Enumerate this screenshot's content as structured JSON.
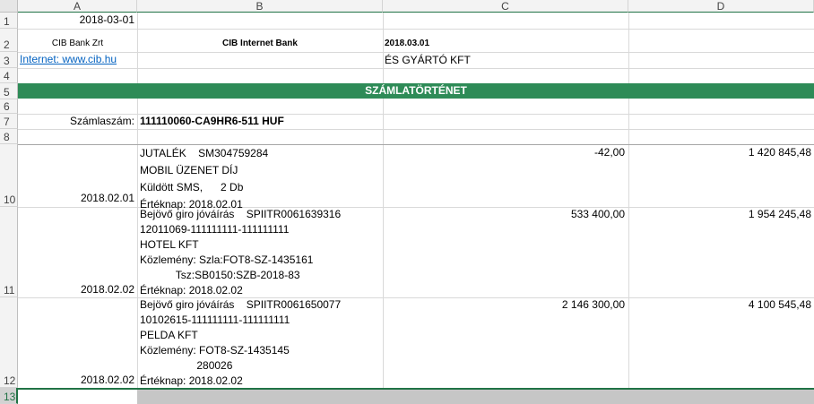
{
  "columns": [
    "A",
    "B",
    "C",
    "D"
  ],
  "rows": [
    "1",
    "2",
    "3",
    "4",
    "5",
    "6",
    "7",
    "8",
    "10",
    "11",
    "12",
    "13"
  ],
  "r1": {
    "a": "2018-03-01"
  },
  "r2": {
    "a": "CIB Bank Zrt",
    "b": "CIB Internet Bank",
    "c": "2018.03.01"
  },
  "r3": {
    "a": "Internet: www.cib.hu",
    "c": "ÉS GYÁRTÓ KFT"
  },
  "r5": {
    "band": "SZÁMLATÖRTÉNET"
  },
  "r7": {
    "a": "Számlaszám:",
    "b": "111110060-CA9HR6-511 HUF"
  },
  "r10": {
    "a": "2018.02.01",
    "b": "JUTALÉK    SM304759284\nMOBIL ÜZENET DÍJ\nKüldött SMS,      2 Db\nÉrtéknap: 2018.02.01",
    "c": "-42,00",
    "d": "1 420 845,48"
  },
  "r11": {
    "a": "2018.02.02",
    "b": "Bejövő giro jóváírás    SPIITR0061639316\n12011069-111111111-111111111\nHOTEL KFT\nKözlemény: Szla:FOT8-SZ-1435161\n            Tsz:SB0150:SZB-2018-83\nÉrtéknap: 2018.02.02",
    "c": "533 400,00",
    "d": "1 954 245,48"
  },
  "r12": {
    "a": "2018.02.02",
    "b": "Bejövő giro jóváírás    SPIITR0061650077\n10102615-111111111-111111111\nPELDA KFT\nKözlemény: FOT8-SZ-1435145\n                   280026\nÉrtéknap: 2018.02.02",
    "c": "2 146 300,00",
    "d": "4 100 545,48"
  },
  "colors": {
    "band": "#2e8b57",
    "link": "#0563c1",
    "selection_border": "#217346"
  }
}
